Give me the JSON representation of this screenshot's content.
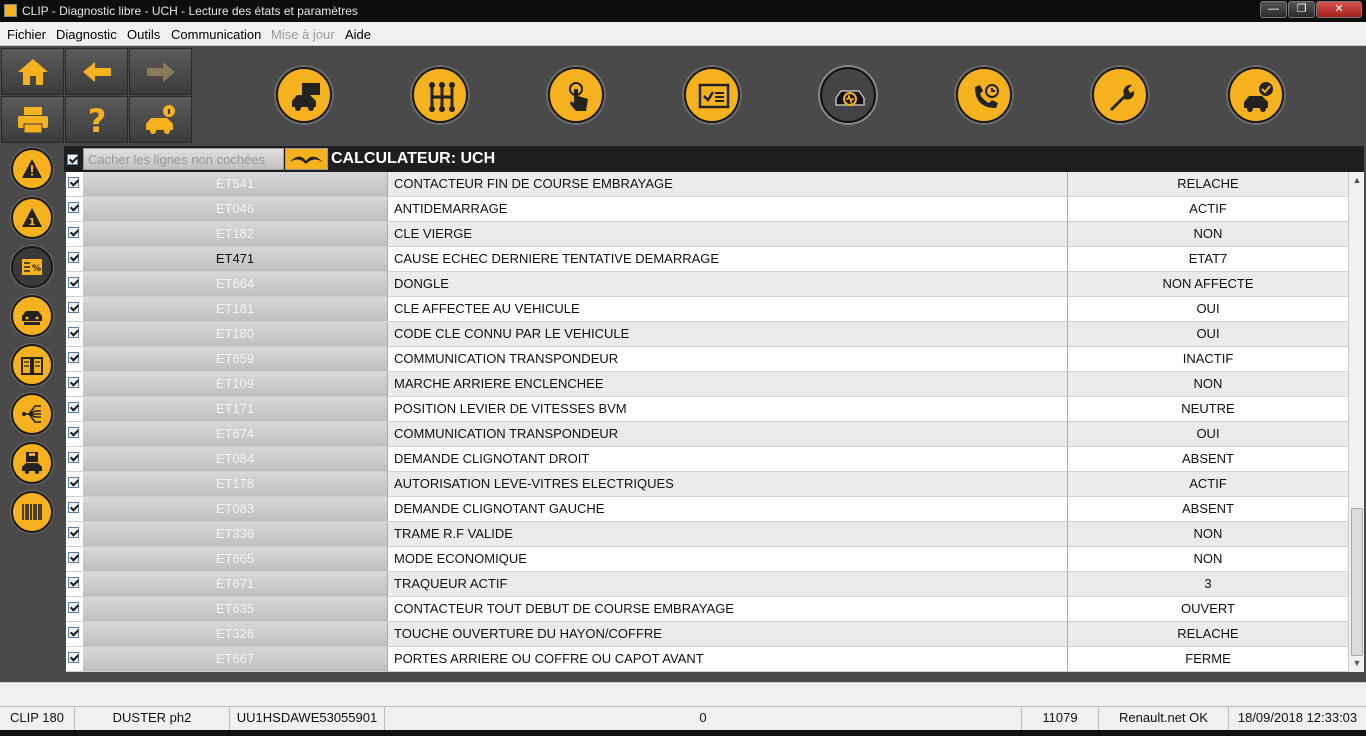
{
  "window": {
    "title": "CLIP - Diagnostic libre - UCH - Lecture des états et paramètres"
  },
  "menu": {
    "items": [
      {
        "label": "Fichier",
        "enabled": true
      },
      {
        "label": "Diagnostic",
        "enabled": true
      },
      {
        "label": "Outils",
        "enabled": true
      },
      {
        "label": "Communication",
        "enabled": true
      },
      {
        "label": "Mise à jour",
        "enabled": false
      },
      {
        "label": "Aide",
        "enabled": true
      }
    ]
  },
  "toolbar": {
    "nav_icons": [
      "home-icon",
      "back-arrow-icon",
      "forward-arrow-icon",
      "print-icon",
      "help-icon",
      "vehicle-info-icon"
    ],
    "function_icons": [
      "vehicle-screen-icon",
      "gearbox-icon",
      "touch-icon",
      "checklist-icon",
      "car-scan-icon",
      "phone-support-icon",
      "wrench-icon",
      "vehicle-check-icon"
    ],
    "active_function": "car-scan-icon"
  },
  "sidebar": {
    "icons": [
      "fault-warning-icon",
      "fault-info-icon",
      "parameters-icon",
      "vehicle-config-icon",
      "manual-book-icon",
      "wiring-icon",
      "save-vehicle-icon",
      "barcode-icon"
    ],
    "active": "parameters-icon"
  },
  "header": {
    "hide_unchecked_label": "Cacher les lignes non cochées",
    "hide_unchecked_checked": true,
    "ecu_title": "CALCULATEUR: UCH"
  },
  "rows": [
    {
      "code": "ET541",
      "name": "CONTACTEUR FIN DE COURSE EMBRAYAGE",
      "value": "RELACHE",
      "highlight": false
    },
    {
      "code": "ET046",
      "name": "ANTIDEMARRAGE",
      "value": "ACTIF",
      "highlight": false
    },
    {
      "code": "ET182",
      "name": "CLE VIERGE",
      "value": "NON",
      "highlight": false
    },
    {
      "code": "ET471",
      "name": "CAUSE ECHEC DERNIERE TENTATIVE DEMARRAGE",
      "value": "ETAT7",
      "highlight": true
    },
    {
      "code": "ET664",
      "name": "DONGLE",
      "value": "NON AFFECTE",
      "highlight": false
    },
    {
      "code": "ET181",
      "name": "CLE AFFECTEE AU VEHICULE",
      "value": "OUI",
      "highlight": false
    },
    {
      "code": "ET180",
      "name": "CODE CLE CONNU PAR LE VEHICULE",
      "value": "OUI",
      "highlight": false
    },
    {
      "code": "ET659",
      "name": "COMMUNICATION TRANSPONDEUR",
      "value": "INACTIF",
      "highlight": false
    },
    {
      "code": "ET109",
      "name": "MARCHE ARRIERE ENCLENCHEE",
      "value": "NON",
      "highlight": false
    },
    {
      "code": "ET171",
      "name": "POSITION LEVIER DE VITESSES BVM",
      "value": "NEUTRE",
      "highlight": false
    },
    {
      "code": "ET674",
      "name": "COMMUNICATION TRANSPONDEUR",
      "value": "OUI",
      "highlight": false
    },
    {
      "code": "ET084",
      "name": "DEMANDE CLIGNOTANT DROIT",
      "value": "ABSENT",
      "highlight": false
    },
    {
      "code": "ET178",
      "name": "AUTORISATION LEVE-VITRES ELECTRIQUES",
      "value": "ACTIF",
      "highlight": false
    },
    {
      "code": "ET083",
      "name": "DEMANDE CLIGNOTANT GAUCHE",
      "value": "ABSENT",
      "highlight": false
    },
    {
      "code": "ET336",
      "name": "TRAME R.F VALIDE",
      "value": "NON",
      "highlight": false
    },
    {
      "code": "ET665",
      "name": "MODE ECONOMIQUE",
      "value": "NON",
      "highlight": false
    },
    {
      "code": "ET671",
      "name": "TRAQUEUR ACTIF",
      "value": "3",
      "highlight": false
    },
    {
      "code": "ET635",
      "name": "CONTACTEUR TOUT DEBUT DE COURSE EMBRAYAGE",
      "value": "OUVERT",
      "highlight": false
    },
    {
      "code": "ET326",
      "name": "TOUCHE OUVERTURE DU HAYON/COFFRE",
      "value": "RELACHE",
      "highlight": false
    },
    {
      "code": "ET667",
      "name": "PORTES ARRIERE OU COFFRE OU CAPOT AVANT",
      "value": "FERME",
      "highlight": false
    }
  ],
  "status": {
    "clip": "CLIP 180",
    "vehicle": "DUSTER ph2",
    "vin": "UU1HSDAWE53055901",
    "center": "0",
    "counter": "11079",
    "renault_net": "Renault.net OK",
    "datetime": "18/09/2018 12:33:03"
  },
  "colors": {
    "accent": "#f6b21e",
    "panel": "#4a4a4a",
    "header": "#1e1e1e"
  }
}
